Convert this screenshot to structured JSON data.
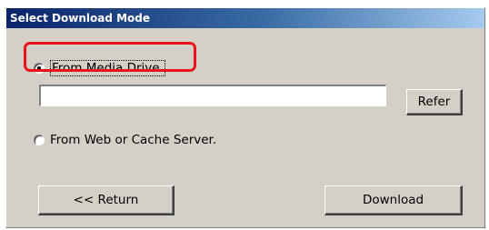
{
  "dialog": {
    "title": "Select Download Mode"
  },
  "media_option": {
    "label": "From Media Drive.",
    "selected": true
  },
  "path_field": {
    "value": "",
    "placeholder": ""
  },
  "web_option": {
    "label": "From Web or Cache Server.",
    "selected": false
  },
  "buttons": {
    "refer_label": "Refer",
    "return_label": "<< Return",
    "download_label": "Download"
  },
  "colors": {
    "title_bar_start": "#0a246a",
    "title_bar_end": "#a6caf0",
    "dialog_background": "#d4d0c8",
    "highlight_outline": "#e8131b"
  }
}
